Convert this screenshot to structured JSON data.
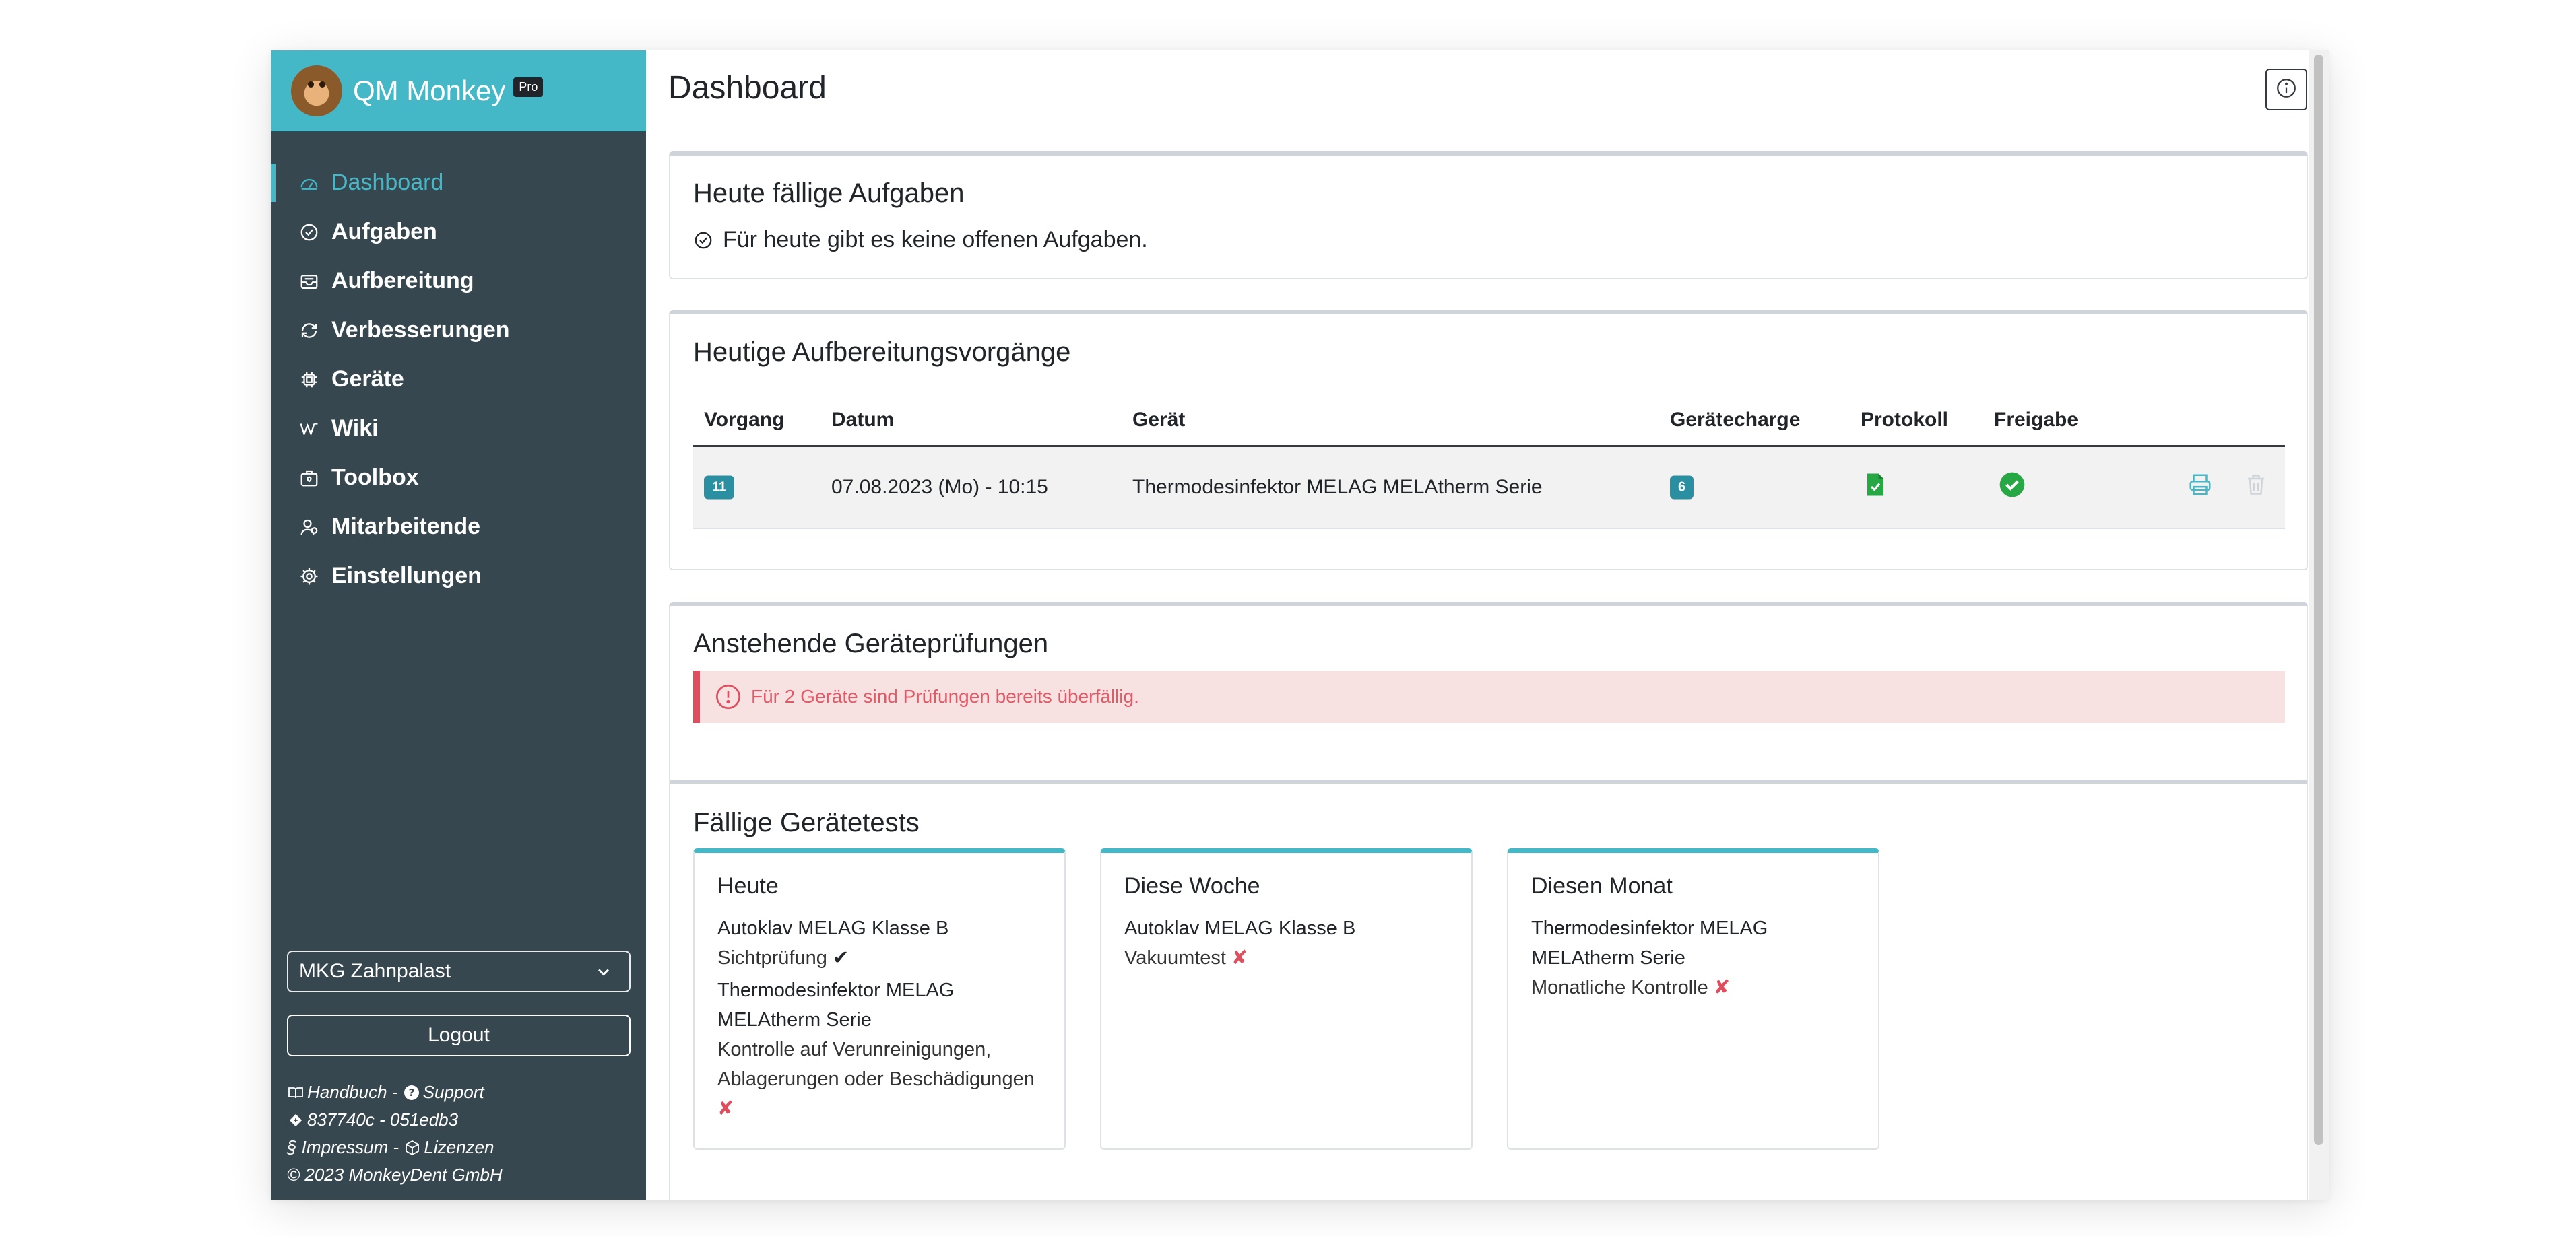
{
  "brand": {
    "name": "QM Monkey",
    "badge": "Pro"
  },
  "nav": [
    {
      "label": "Dashboard",
      "icon": "dashboard-icon"
    },
    {
      "label": "Aufgaben",
      "icon": "check-circle-icon"
    },
    {
      "label": "Aufbereitung",
      "icon": "inbox-icon"
    },
    {
      "label": "Verbesserungen",
      "icon": "refresh-icon"
    },
    {
      "label": "Geräte",
      "icon": "chip-icon"
    },
    {
      "label": "Wiki",
      "icon": "wiki-icon"
    },
    {
      "label": "Toolbox",
      "icon": "toolbox-icon"
    },
    {
      "label": "Mitarbeitende",
      "icon": "users-icon"
    },
    {
      "label": "Einstellungen",
      "icon": "gear-icon"
    }
  ],
  "site": {
    "selected": "MKG Zahnpalast"
  },
  "logout": "Logout",
  "footer": {
    "handbuch": "Handbuch",
    "sep": " - ",
    "support": "Support",
    "version": "837740c - 051edb3",
    "impressum": "§ Impressum - ",
    "lizenzen": "Lizenzen",
    "copyright": "© 2023 MonkeyDent GmbH"
  },
  "page": {
    "title": "Dashboard"
  },
  "tasks": {
    "title": "Heute fällige Aufgaben",
    "message": "Für heute gibt es keine offenen Aufgaben."
  },
  "processes": {
    "title": "Heutige Aufbereitungsvorgänge",
    "columns": [
      "Vorgang",
      "Datum",
      "Gerät",
      "Gerätecharge",
      "Protokoll",
      "Freigabe"
    ],
    "rows": [
      {
        "vorgang": "11",
        "datum": "07.08.2023 (Mo) - 10:15",
        "geraet": "Thermodesinfektor MELAG MELAtherm Serie",
        "charge": "6"
      }
    ]
  },
  "inspections": {
    "title": "Anstehende Geräteprüfungen",
    "alert": "Für 2 Geräte sind Prüfungen bereits überfällig."
  },
  "tests": {
    "title": "Fällige Gerätetests",
    "columns": [
      {
        "title": "Heute",
        "items": [
          {
            "device": "Autoklav MELAG Klasse B",
            "test": "Sichtprüfung",
            "mark": "✔"
          },
          {
            "device": "Thermodesinfektor MELAG MELAtherm Serie",
            "test": "Kontrolle auf Verunreinigungen, Ablagerungen oder Beschädigungen",
            "mark": "✘"
          }
        ]
      },
      {
        "title": "Diese Woche",
        "items": [
          {
            "device": "Autoklav MELAG Klasse B",
            "test": "Vakuumtest",
            "mark": "✘"
          }
        ]
      },
      {
        "title": "Diesen Monat",
        "items": [
          {
            "device": "Thermodesinfektor MELAG MELAtherm Serie",
            "test": "Monatliche Kontrolle",
            "mark": "✘"
          }
        ]
      }
    ]
  },
  "colors": {
    "accent": "#45b8c8",
    "sidebar": "#37474f",
    "danger": "#e04e5e",
    "success": "#28a745"
  }
}
